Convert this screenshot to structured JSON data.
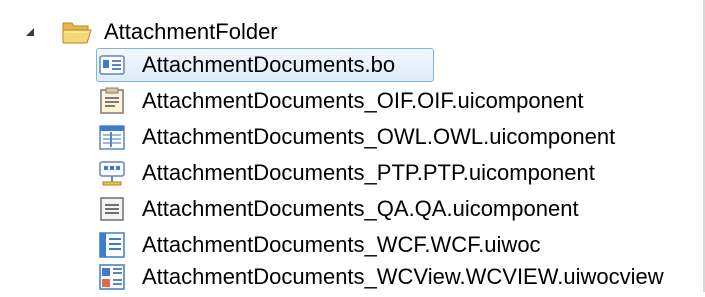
{
  "tree": {
    "folder": {
      "label": "AttachmentFolder",
      "expanded": true,
      "icon": "folder-open-icon"
    },
    "items": [
      {
        "label": "AttachmentDocuments.bo",
        "icon": "business-object-icon",
        "selected": true
      },
      {
        "label": "AttachmentDocuments_OIF.OIF.uicomponent",
        "icon": "oif-component-icon",
        "selected": false
      },
      {
        "label": "AttachmentDocuments_OWL.OWL.uicomponent",
        "icon": "owl-component-icon",
        "selected": false
      },
      {
        "label": "AttachmentDocuments_PTP.PTP.uicomponent",
        "icon": "ptp-component-icon",
        "selected": false
      },
      {
        "label": "AttachmentDocuments_QA.QA.uicomponent",
        "icon": "qa-component-icon",
        "selected": false
      },
      {
        "label": "AttachmentDocuments_WCF.WCF.uiwoc",
        "icon": "wcf-uiwoc-icon",
        "selected": false
      },
      {
        "label": "AttachmentDocuments_WCView.WCVIEW.uiwocview",
        "icon": "wcview-uiwocview-icon",
        "selected": false
      }
    ]
  },
  "colors": {
    "selection_border": "#7fb4e0",
    "selection_fill": "#ddecfa",
    "folder_yellow": "#f2cf6a",
    "icon_blue": "#3d7cc9"
  }
}
